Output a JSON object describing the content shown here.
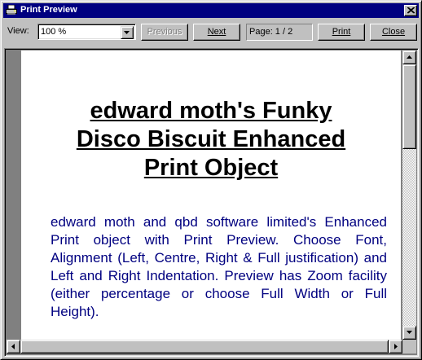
{
  "window": {
    "title": "Print Preview"
  },
  "toolbar": {
    "view_label": "View:",
    "zoom_value": "100 %",
    "previous_label": "Previous",
    "next_label": "Next",
    "page_indicator": "Page: 1 / 2",
    "print_label": "Print",
    "close_label": "Close"
  },
  "document": {
    "title_lines": [
      "edward moth's Funky",
      "Disco Biscuit Enhanced",
      "Print Object"
    ],
    "body": "edward moth and qbd software limited's Enhanced Print object with Print Preview. Choose Font, Alignment (Left, Centre, Right & Full justification) and Left and Right Indentation. Preview has Zoom facility (either percentage or choose Full Width or Full Height).",
    "body_color": "#000080"
  },
  "colors": {
    "titlebar": "#000080",
    "face": "#c0c0c0",
    "viewport_bg": "#808080"
  }
}
